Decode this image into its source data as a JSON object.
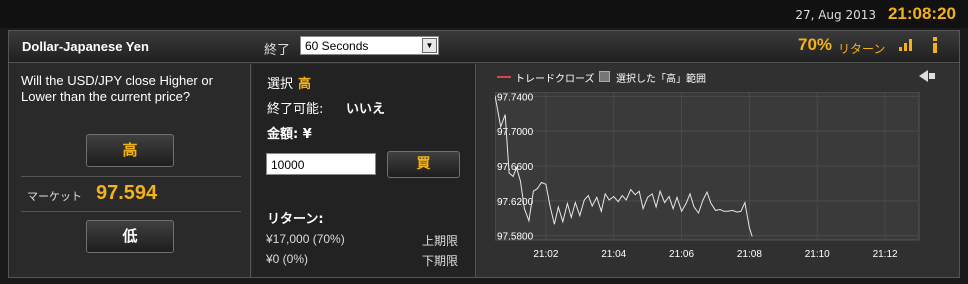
{
  "topbar": {
    "date": "27, Aug 2013",
    "time": "21:08:20"
  },
  "header": {
    "asset": "Dollar-Japanese Yen",
    "expiry_label": "終了",
    "expiry_value": "60 Seconds",
    "return_pct": "70%",
    "return_label": "リターン",
    "signal_icon": "signal-bars-icon",
    "info_icon": "info-icon"
  },
  "left": {
    "question": "Will the USD/JPY close Higher or Lower than the current price?",
    "high_label": "高",
    "low_label": "低",
    "market_label": "マーケット",
    "market_price": "97.594"
  },
  "middle": {
    "selection_label": "選択",
    "selection_value": "高",
    "early_close_label": "終了可能:",
    "early_close_value": "いいえ",
    "amount_label": "金額: ¥",
    "amount_value": "10000",
    "buy_label": "買",
    "returns_label": "リターン:",
    "upper_return_value": "¥17,000 (70%)",
    "upper_return_label": "上期限",
    "lower_return_value": "¥0 (0%)",
    "lower_return_label": "下期限"
  },
  "chart_legend": {
    "trend_label": "トレードクローズ",
    "range_label": "選択した「高」範囲",
    "trend_color": "#d84343"
  },
  "chart_data": {
    "type": "line",
    "y_ticks": [
      "97.7400",
      "97.7000",
      "97.6600",
      "97.6200",
      "97.5800"
    ],
    "x_ticks": [
      "21:02",
      "21:04",
      "21:06",
      "21:08",
      "21:10",
      "21:12"
    ],
    "ylim": [
      97.575,
      97.745
    ],
    "xlim": [
      "21:00:30",
      "21:13:00"
    ],
    "series": [
      {
        "x": [
          "21:00:30",
          "21:00:40",
          "21:00:48",
          "21:00:55",
          "21:01:02",
          "21:01:08",
          "21:01:15",
          "21:01:22",
          "21:01:30",
          "21:01:38",
          "21:01:45",
          "21:01:52",
          "21:02:00",
          "21:02:08",
          "21:02:15",
          "21:02:22",
          "21:02:30",
          "21:02:38",
          "21:02:45",
          "21:02:52",
          "21:03:00",
          "21:03:08",
          "21:03:15",
          "21:03:22",
          "21:03:30",
          "21:03:38",
          "21:03:45",
          "21:03:52",
          "21:04:00",
          "21:04:08",
          "21:04:15",
          "21:04:22",
          "21:04:30",
          "21:04:38",
          "21:04:45",
          "21:04:52",
          "21:05:00",
          "21:05:08",
          "21:05:15",
          "21:05:22",
          "21:05:30",
          "21:05:38",
          "21:05:45",
          "21:05:52",
          "21:06:00",
          "21:06:08",
          "21:06:15",
          "21:06:22",
          "21:06:30",
          "21:06:38",
          "21:06:45",
          "21:06:52",
          "21:07:00",
          "21:07:08",
          "21:07:15",
          "21:07:22",
          "21:07:30",
          "21:07:38",
          "21:07:45",
          "21:07:52",
          "21:08:00",
          "21:08:05"
        ],
        "y": [
          97.741,
          97.705,
          97.719,
          97.652,
          97.648,
          97.658,
          97.643,
          97.611,
          97.597,
          97.631,
          97.634,
          97.641,
          97.639,
          97.612,
          97.593,
          97.613,
          97.596,
          97.617,
          97.601,
          97.618,
          97.603,
          97.621,
          97.626,
          97.614,
          97.624,
          97.608,
          97.628,
          97.621,
          97.625,
          97.619,
          97.626,
          97.621,
          97.633,
          97.627,
          97.631,
          97.611,
          97.624,
          97.628,
          97.613,
          97.631,
          97.618,
          97.625,
          97.611,
          97.624,
          97.608,
          97.617,
          97.628,
          97.613,
          97.606,
          97.621,
          97.63,
          97.617,
          97.609,
          97.61,
          97.608,
          97.608,
          97.609,
          97.607,
          97.608,
          97.618,
          97.589,
          97.579
        ]
      }
    ]
  }
}
